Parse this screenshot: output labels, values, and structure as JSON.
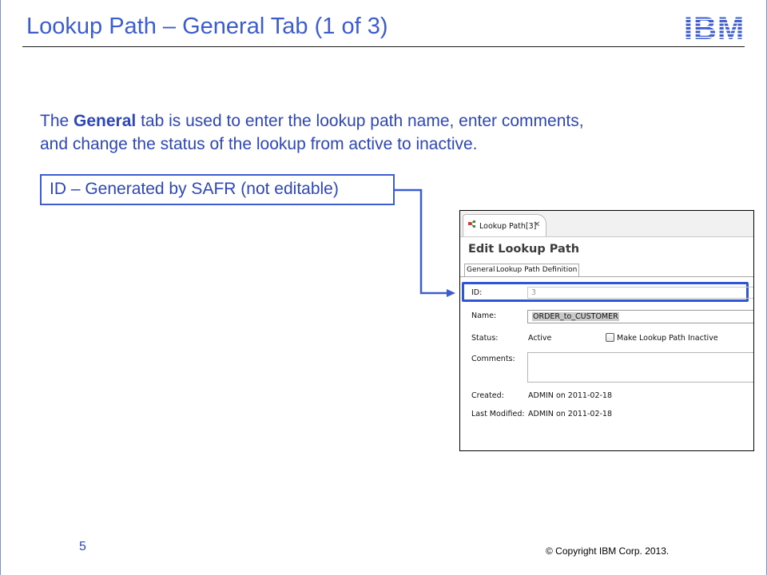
{
  "slide": {
    "title": "Lookup Path – General Tab (1 of 3)",
    "intro_prefix": "The ",
    "intro_bold": "General",
    "intro_line1_rest": " tab is used to enter the lookup path name, enter comments,",
    "intro_line2": "and change the status of the lookup from active to inactive.",
    "callout": "ID – Generated by SAFR (not editable)",
    "page_number": "5",
    "copyright": "© Copyright  IBM Corp. 2013.",
    "logo": "IBM",
    "colors": {
      "accent": "#3d5ccf",
      "text_blue": "#2e47b8",
      "highlight_box": "#2f56d6"
    }
  },
  "screenshot": {
    "editor_tab": {
      "label": "Lookup Path[3]",
      "icon": "lookup-path-icon",
      "close_icon": "close-icon"
    },
    "heading": "Edit Lookup Path",
    "tabs": [
      "General",
      "Lookup Path Definition"
    ],
    "form": {
      "id_label": "ID:",
      "id_value": "3",
      "name_label": "Name:",
      "name_value": "ORDER_to_CUSTOMER",
      "status_label": "Status:",
      "status_value": "Active",
      "inactive_checkbox_label": "Make Lookup Path Inactive",
      "inactive_checked": false,
      "comments_label": "Comments:",
      "comments_value": "",
      "created_label": "Created:",
      "created_value": "ADMIN on 2011-02-18",
      "modified_label": "Last Modified:",
      "modified_value": "ADMIN on 2011-02-18"
    }
  }
}
